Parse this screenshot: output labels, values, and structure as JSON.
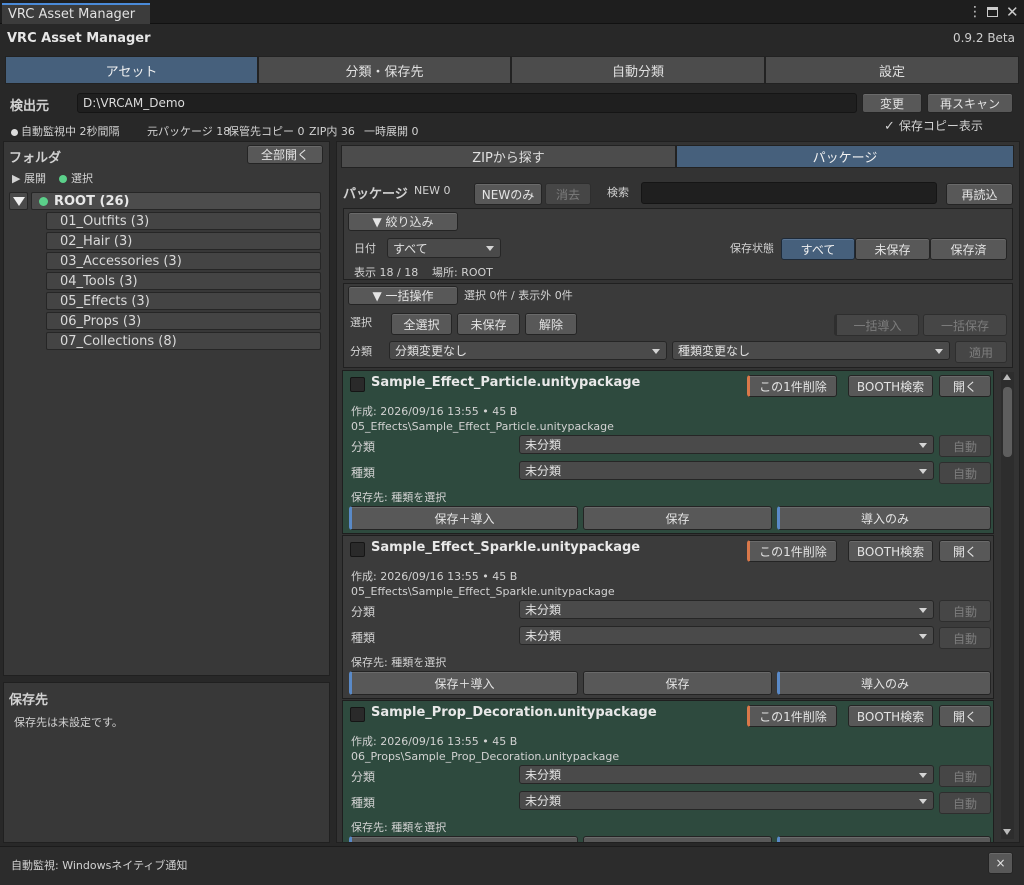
{
  "window": {
    "tab_title": "VRC Asset Manager",
    "app_title": "VRC Asset Manager",
    "version": "0.9.2 Beta"
  },
  "main_tabs": [
    "アセット",
    "分類・保存先",
    "自動分類",
    "設定"
  ],
  "source": {
    "label": "検出元",
    "path": "D:\\VRCAM_Demo",
    "change_btn": "変更",
    "rescan_btn": "再スキャン",
    "show_copy_label": "保存コピー表示",
    "show_copy_checked": true
  },
  "status": {
    "monitor": "自動監視中 2秒間隔",
    "packages": "元パッケージ 18",
    "copies": "保管先コピー 0",
    "zip": "ZIP内 36",
    "temp": "一時展開 0"
  },
  "folder": {
    "title": "フォルダ",
    "expand_all": "全部開く",
    "legend_expand": "▶ 展開",
    "legend_select": "選択",
    "root": "ROOT (26)",
    "items": [
      "01_Outfits (3)",
      "02_Hair (3)",
      "03_Accessories (3)",
      "04_Tools (3)",
      "05_Effects (3)",
      "06_Props (3)",
      "07_Collections (8)"
    ]
  },
  "save_dest": {
    "title": "保存先",
    "empty": "保存先は未設定です。"
  },
  "right_tabs": [
    "ZIPから探す",
    "パッケージ"
  ],
  "toolbar": {
    "title": "パッケージ",
    "new_count": "NEW 0",
    "new_only": "NEWのみ",
    "clear": "消去",
    "search_label": "検索",
    "search_value": "",
    "reload": "再読込"
  },
  "filter": {
    "toggle": "▼ 絞り込み",
    "date_label": "日付",
    "date_value": "すべて",
    "save_state_label": "保存状態",
    "state_all": "すべて",
    "state_unsaved": "未保存",
    "state_saved": "保存済",
    "display": "表示 18 / 18",
    "location": "場所: ROOT"
  },
  "bulk": {
    "toggle": "▼ 一括操作",
    "selection_info": "選択 0件 / 表示外 0件",
    "select_label": "選択",
    "select_all": "全選択",
    "unsaved": "未保存",
    "release": "解除",
    "bulk_import": "一括導入",
    "bulk_save": "一括保存",
    "category_label": "分類",
    "category_value": "分類変更なし",
    "kind_value": "種類変更なし",
    "apply": "適用"
  },
  "packages": [
    {
      "name": "Sample_Effect_Particle.unitypackage",
      "meta": "作成: 2026/09/16 13:55 • 45 B",
      "path": "05_Effects\\Sample_Effect_Particle.unitypackage",
      "category": "未分類",
      "kind": "未分類",
      "dest": "保存先: 種類を選択",
      "delete": "この1件削除",
      "booth": "BOOTH検索",
      "open": "開く",
      "auto": "自動",
      "save_import": "保存＋導入",
      "save": "保存",
      "import_only": "導入のみ"
    },
    {
      "name": "Sample_Effect_Sparkle.unitypackage",
      "meta": "作成: 2026/09/16 13:55 • 45 B",
      "path": "05_Effects\\Sample_Effect_Sparkle.unitypackage",
      "category": "未分類",
      "kind": "未分類",
      "dest": "保存先: 種類を選択",
      "delete": "この1件削除",
      "booth": "BOOTH検索",
      "open": "開く",
      "auto": "自動",
      "save_import": "保存＋導入",
      "save": "保存",
      "import_only": "導入のみ"
    },
    {
      "name": "Sample_Prop_Decoration.unitypackage",
      "meta": "作成: 2026/09/16 13:55 • 45 B",
      "path": "06_Props\\Sample_Prop_Decoration.unitypackage",
      "category": "未分類",
      "kind": "未分類",
      "dest": "保存先: 種類を選択",
      "delete": "この1件削除",
      "booth": "BOOTH検索",
      "open": "開く",
      "auto": "自動"
    }
  ],
  "card_labels": {
    "category": "分類",
    "kind": "種類"
  },
  "footer": {
    "monitor": "自動監視: Windowsネイティブ通知",
    "close": "×"
  },
  "colors": {
    "accent": "#46607c",
    "green_dot": "#5bd08a",
    "card_green": "#2e4a3e"
  }
}
